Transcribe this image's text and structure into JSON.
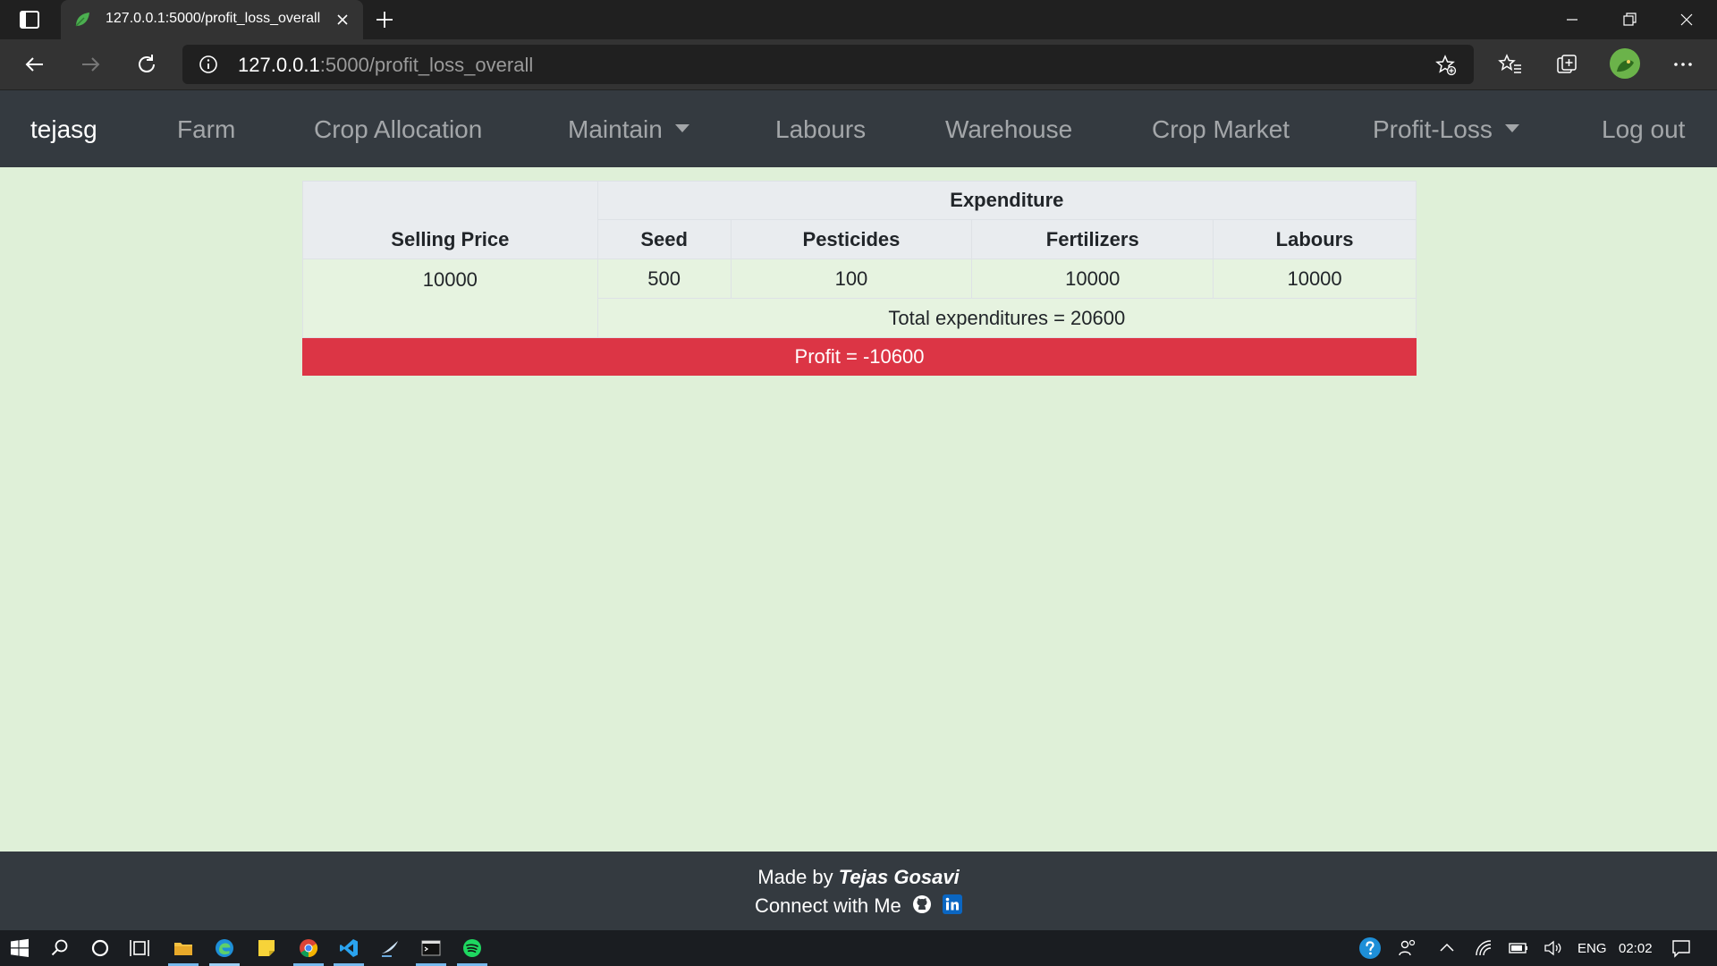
{
  "browser": {
    "tab_title": "127.0.0.1:5000/profit_loss_overall",
    "url_host": "127.0.0.1",
    "url_rest": ":5000/profit_loss_overall"
  },
  "navbar": {
    "brand": "tejasg",
    "items": [
      "Farm",
      "Crop Allocation",
      "Maintain",
      "Labours",
      "Warehouse",
      "Crop Market",
      "Profit-Loss",
      "Log out"
    ]
  },
  "table": {
    "group_header": "Expenditure",
    "selling_price_header": "Selling Price",
    "columns": [
      "Seed",
      "Pesticides",
      "Fertilizers",
      "Labours"
    ],
    "selling_price": "10000",
    "values": [
      "500",
      "100",
      "10000",
      "10000"
    ],
    "total_text": "Total expenditures = 20600",
    "profit_text": "Profit = -10600"
  },
  "footer": {
    "made_by_prefix": "Made by",
    "made_by_name": "Tejas Gosavi",
    "connect_text": "Connect with Me"
  },
  "taskbar": {
    "language": "ENG",
    "time": "02:02"
  },
  "colors": {
    "page_bg": "#dff0d8",
    "navbar_bg": "#343a40",
    "profit_negative": "#dc3545",
    "header_bg": "#e9ecef"
  }
}
